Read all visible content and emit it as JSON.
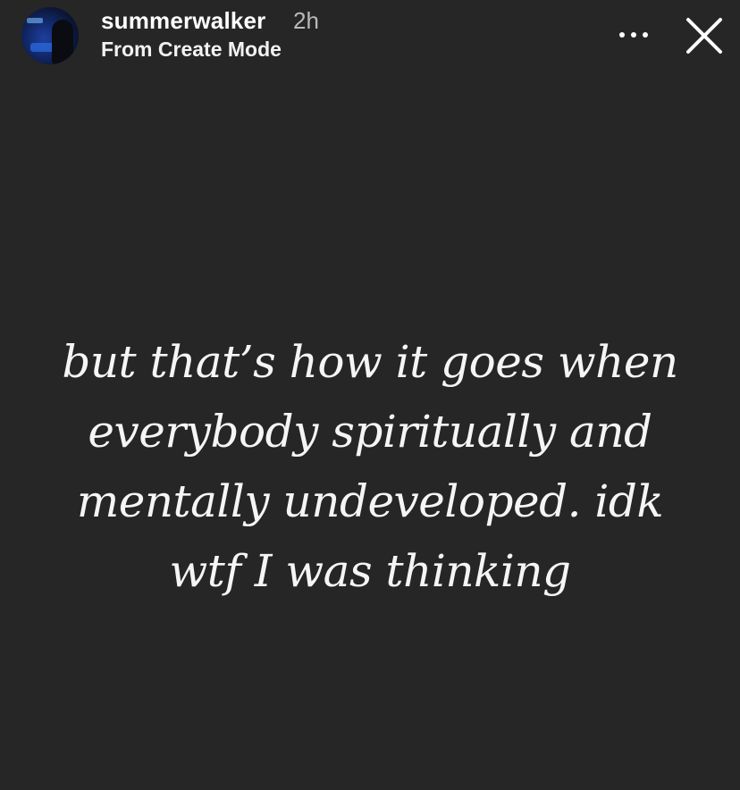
{
  "story": {
    "username": "summerwalker",
    "time_ago": "2h",
    "subtitle": "From Create Mode",
    "avatar_icon": "profile-avatar",
    "more_icon": "more-horizontal-icon",
    "close_icon": "close-x-icon",
    "caption_lines": [
      "but that’s how it goes when",
      "everybody spiritually and",
      "mentally undeveloped. idk",
      "wtf I was thinking"
    ]
  },
  "colors": {
    "background": "#262626",
    "text": "#ffffff",
    "muted": "#b9b9b9"
  }
}
